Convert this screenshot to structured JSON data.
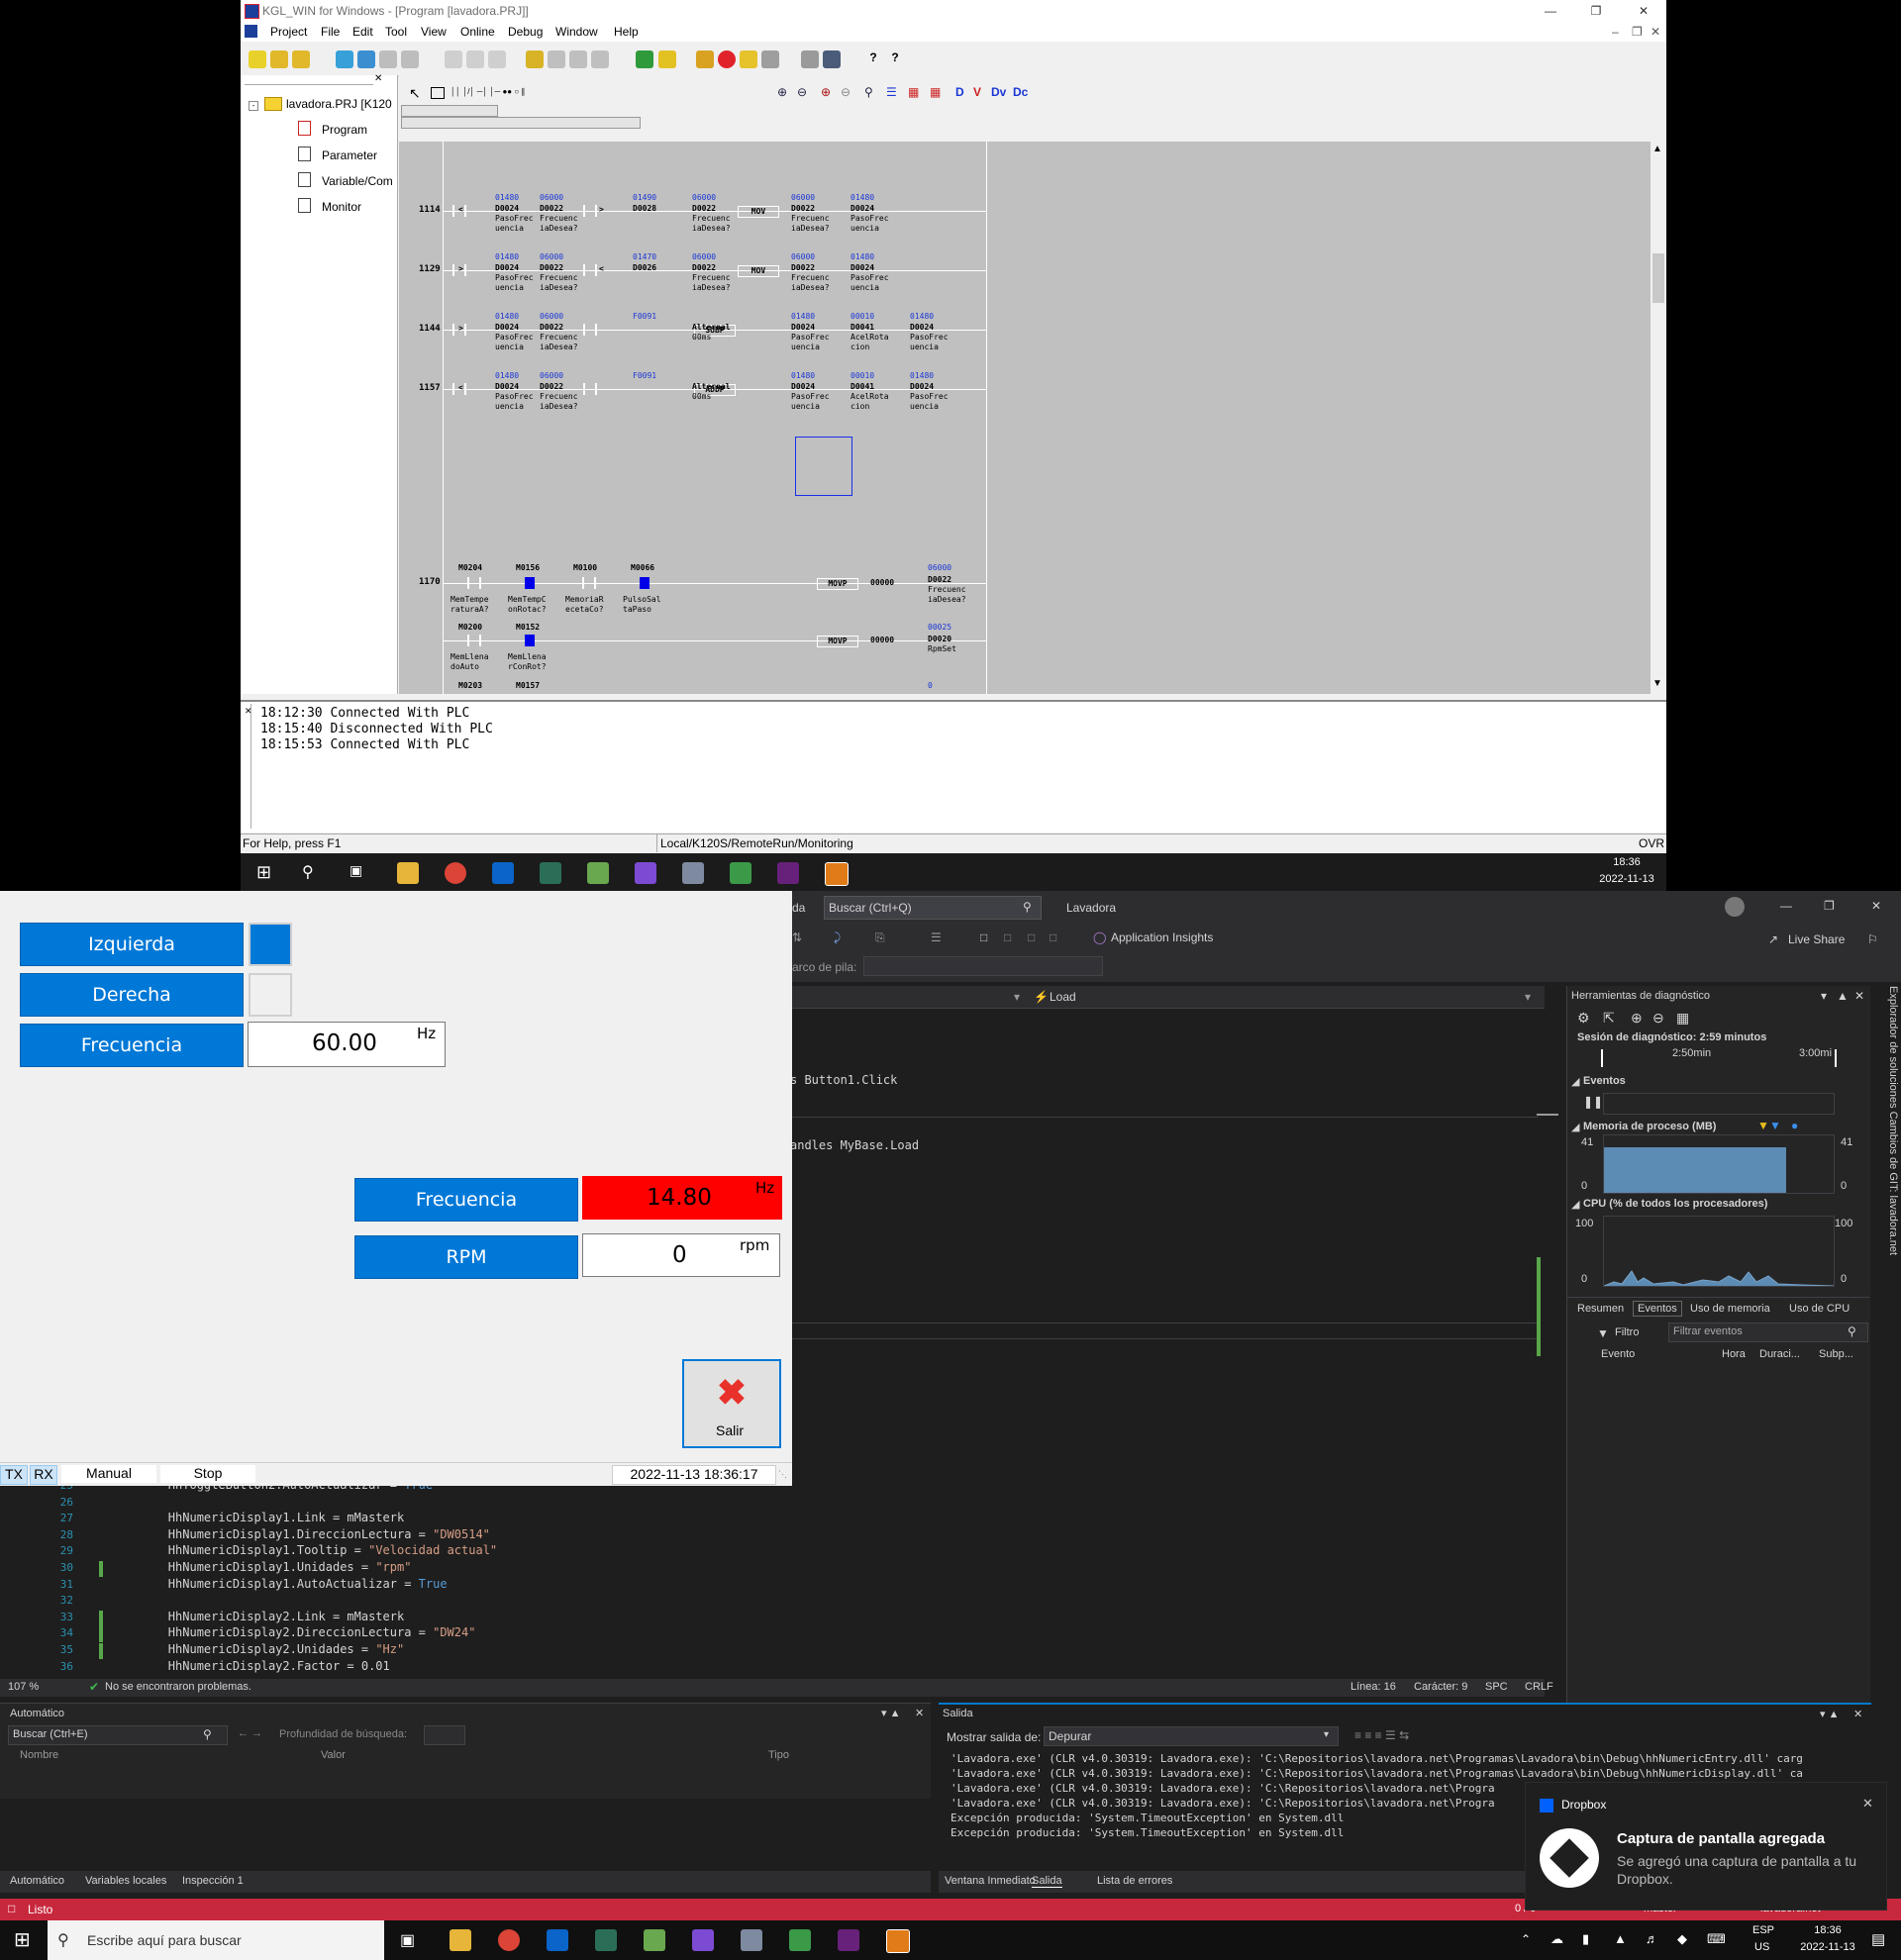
{
  "kgl": {
    "title": "KGL_WIN for Windows - [Program [lavadora.PRJ]]",
    "menu": [
      "Project",
      "File",
      "Edit",
      "Tool",
      "View",
      "Online",
      "Debug",
      "Window",
      "Help"
    ],
    "tree": {
      "root": "lavadora.PRJ [K120",
      "items": [
        "Program",
        "Parameter",
        "Variable/Com",
        "Monitor"
      ]
    },
    "rungs": [
      {
        "no": "1114",
        "op1": "<",
        "a1": "01480",
        "r1": "D0024",
        "c1a": "PasoFrec",
        "c1b": "uencia",
        "a2": "06000",
        "r2": "D0022",
        "c2a": "Frecuenc",
        "c2b": "iaDesea?",
        "op2": ">",
        "a3": "01490",
        "r3": "D0028",
        "a4": "06000",
        "r4": "D0022",
        "c4a": "Frecuenc",
        "c4b": "iaDesea?",
        "fn": "MOV",
        "a5": "06000",
        "r5": "D0022",
        "c5a": "Frecuenc",
        "c5b": "iaDesea?",
        "a6": "01480",
        "r6": "D0024",
        "c6a": "PasoFrec",
        "c6b": "uencia"
      },
      {
        "no": "1129",
        "op1": ">",
        "a1": "01480",
        "r1": "D0024",
        "c1a": "PasoFrec",
        "c1b": "uencia",
        "a2": "06000",
        "r2": "D0022",
        "c2a": "Frecuenc",
        "c2b": "iaDesea?",
        "op2": "<",
        "a3": "01470",
        "r3": "D0026",
        "a4": "06000",
        "r4": "D0022",
        "c4a": "Frecuenc",
        "c4b": "iaDesea?",
        "fn": "MOV",
        "a5": "06000",
        "r5": "D0022",
        "c5a": "Frecuenc",
        "c5b": "iaDesea?",
        "a6": "01480",
        "r6": "D0024",
        "c6a": "PasoFrec",
        "c6b": "uencia"
      },
      {
        "no": "1144",
        "op1": ">",
        "a1": "01480",
        "r1": "D0024",
        "c1a": "PasoFrec",
        "c1b": "uencia",
        "a2": "06000",
        "r2": "D0022",
        "c2a": "Frecuenc",
        "c2b": "iaDesea?",
        "op2": "",
        "a3": "F0091",
        "r3": "",
        "a4": "",
        "r4": "Alternal",
        "c4a": "00ms",
        "c4b": "",
        "fn": "SUBP",
        "a5": "01480",
        "r5": "D0024",
        "c5a": "PasoFrec",
        "c5b": "uencia",
        "a6": "00010",
        "r6": "D0041",
        "c6a": "AcelRota",
        "c6b": "cion",
        "a7": "01480",
        "r7": "D0024",
        "c7a": "PasoFrec",
        "c7b": "uencia"
      },
      {
        "no": "1157",
        "op1": "<",
        "a1": "01480",
        "r1": "D0024",
        "c1a": "PasoFrec",
        "c1b": "uencia",
        "a2": "06000",
        "r2": "D0022",
        "c2a": "Frecuenc",
        "c2b": "iaDesea?",
        "op2": "",
        "a3": "F0091",
        "r3": "",
        "a4": "",
        "r4": "Alternal",
        "c4a": "00ms",
        "c4b": "",
        "fn": "ADDP",
        "a5": "01480",
        "r5": "D0024",
        "c5a": "PasoFrec",
        "c5b": "uencia",
        "a6": "00010",
        "r6": "D0041",
        "c6a": "AcelRota",
        "c6b": "cion",
        "a7": "01480",
        "r7": "D0024",
        "c7a": "PasoFrec",
        "c7b": "uencia"
      }
    ],
    "rung1170": {
      "no": "1170",
      "m1": "M0204",
      "m1a": "MemTempe",
      "m1b": "raturaA?",
      "m2": "M0156",
      "m2a": "MemTempC",
      "m2b": "onRotac?",
      "m3": "M0100",
      "m3a": "MemoriaR",
      "m3b": "ecetaCo?",
      "m4": "M0066",
      "m4a": "PulsoSal",
      "m4b": "taPaso",
      "m5": "M0200",
      "m5a": "MemLlena",
      "m5b": "doAuto",
      "m6": "M0152",
      "m6a": "MemLlena",
      "m6b": "rConRot?",
      "m7": "M0203",
      "m8": "M0157",
      "fn1": "MOVP",
      "v1": "00000",
      "a1": "06000",
      "r1": "D0022",
      "r1a": "Frecuenc",
      "r1b": "iaDesea?",
      "fn2": "MOVP",
      "v2": "00000",
      "a2": "00025",
      "r2": "D0020",
      "r2a": "RpmSet",
      "a3": "0"
    },
    "messages": [
      "18:12:30 Connected With PLC",
      "18:15:40 Disconnected With PLC",
      "18:15:53 Connected With PLC"
    ],
    "status": {
      "help": "For Help, press F1",
      "mode": "Local/K120S/RemoteRun/Monitoring",
      "ovr": "OVR"
    }
  },
  "taskbar_top": {
    "time": "18:36",
    "date": "2022-11-13"
  },
  "app": {
    "btn_izquierda": "Izquierda",
    "btn_derecha": "Derecha",
    "btn_frecuencia": "Frecuencia",
    "freq_set": "60.00",
    "freq_set_unit": "Hz",
    "lbl_frecuencia": "Frecuencia",
    "freq_actual": "14.80",
    "freq_actual_unit": "Hz",
    "lbl_rpm": "RPM",
    "rpm_value": "0",
    "rpm_unit": "rpm",
    "salir": "Salir",
    "status": {
      "tx": "TX",
      "rx": "RX",
      "manual": "Manual",
      "stop": "Stop",
      "datetime": "2022-11-13 18:36:17"
    },
    "colors": {
      "button": "#0078d7",
      "alarm": "#ff0000"
    }
  },
  "vs": {
    "search_placeholder": "Buscar (Ctrl+Q)",
    "solution": "Lavadora",
    "app_insights": "Application Insights",
    "live_share": "Live Share",
    "stack_frame": "Marco de pila:",
    "method_dropdown": "Load",
    "code_top": [
      {
        "text": "s Button1.Click"
      },
      {
        "text": "andles MyBase.Load"
      }
    ],
    "code_lines": [
      {
        "n": "25",
        "t": "        HhToggleButton2.AutoActualizar = True"
      },
      {
        "n": "26",
        "t": ""
      },
      {
        "n": "27",
        "t": "        HhNumericDisplay1.Link = mMasterk"
      },
      {
        "n": "28",
        "t": "        HhNumericDisplay1.DireccionLectura = \"DW0514\""
      },
      {
        "n": "29",
        "t": "        HhNumericDisplay1.Tooltip = \"Velocidad actual\""
      },
      {
        "n": "30",
        "t": "        HhNumericDisplay1.Unidades = \"rpm\""
      },
      {
        "n": "31",
        "t": "        HhNumericDisplay1.AutoActualizar = True"
      },
      {
        "n": "32",
        "t": ""
      },
      {
        "n": "33",
        "t": "        HhNumericDisplay2.Link = mMasterk"
      },
      {
        "n": "34",
        "t": "        HhNumericDisplay2.DireccionLectura = \"DW24\""
      },
      {
        "n": "35",
        "t": "        HhNumericDisplay2.Unidades = \"Hz\""
      },
      {
        "n": "36",
        "t": "        HhNumericDisplay2.Factor = 0.01"
      }
    ],
    "editor_status": {
      "zoom": "107 %",
      "problems": "No se encontraron problemas.",
      "line": "Línea: 16",
      "char": "Carácter: 9",
      "spc": "SPC",
      "crlf": "CRLF"
    },
    "diag": {
      "title": "Herramientas de diagnóstico",
      "session": "Sesión de diagnóstico: 2:59 minutos",
      "t1": "2:50min",
      "t2": "3:00mi",
      "events": "Eventos",
      "mem": "Memoria de proceso (MB)",
      "mem_max": "41",
      "mem_min": "0",
      "cpu": "CPU (% de todos los procesadores)",
      "cpu_max": "100",
      "cpu_min": "0",
      "tabs": [
        "Resumen",
        "Eventos",
        "Uso de memoria",
        "Uso de CPU"
      ],
      "filter": "Filtro",
      "filter_placeholder": "Filtrar eventos",
      "cols": [
        "Evento",
        "Hora",
        "Duraci...",
        "Subp..."
      ]
    },
    "side_tabs": "Explorador de soluciones   Cambios de GIT: lavadora.net",
    "autos": {
      "title": "Automático",
      "search": "Buscar (Ctrl+E)",
      "depth": "Profundidad de búsqueda:",
      "cols": [
        "Nombre",
        "Valor",
        "Tipo"
      ],
      "tabs": [
        "Automático",
        "Variables locales",
        "Inspección 1"
      ]
    },
    "output": {
      "title": "Salida",
      "show_from": "Mostrar salida de:",
      "source": "Depurar",
      "lines": [
        "'Lavadora.exe' (CLR v4.0.30319: Lavadora.exe): 'C:\\Repositorios\\lavadora.net\\Programas\\Lavadora\\bin\\Debug\\hhNumericEntry.dll' carg",
        "'Lavadora.exe' (CLR v4.0.30319: Lavadora.exe): 'C:\\Repositorios\\lavadora.net\\Programas\\Lavadora\\bin\\Debug\\hhNumericDisplay.dll' ca",
        "'Lavadora.exe' (CLR v4.0.30319: Lavadora.exe): 'C:\\Repositorios\\lavadora.net\\Progra",
        "'Lavadora.exe' (CLR v4.0.30319: Lavadora.exe): 'C:\\Repositorios\\lavadora.net\\Progra",
        "Excepción producida: 'System.TimeoutException' en System.dll",
        "Excepción producida: 'System.TimeoutException' en System.dll"
      ],
      "tabs": [
        "Ventana Inmediato",
        "Salida",
        "Lista de errores"
      ]
    },
    "status": {
      "ready": "Listo",
      "changes": "0 / 0",
      "branch": "master",
      "repo": "lavadora.net"
    }
  },
  "toast": {
    "app": "Dropbox",
    "title": "Captura de pantalla agregada",
    "body": "Se agregó una captura de pantalla a tu Dropbox."
  },
  "taskbar": {
    "search": "Escribe aquí para buscar",
    "lang1": "ESP",
    "lang2": "US",
    "time": "18:36",
    "date": "2022-11-13"
  }
}
